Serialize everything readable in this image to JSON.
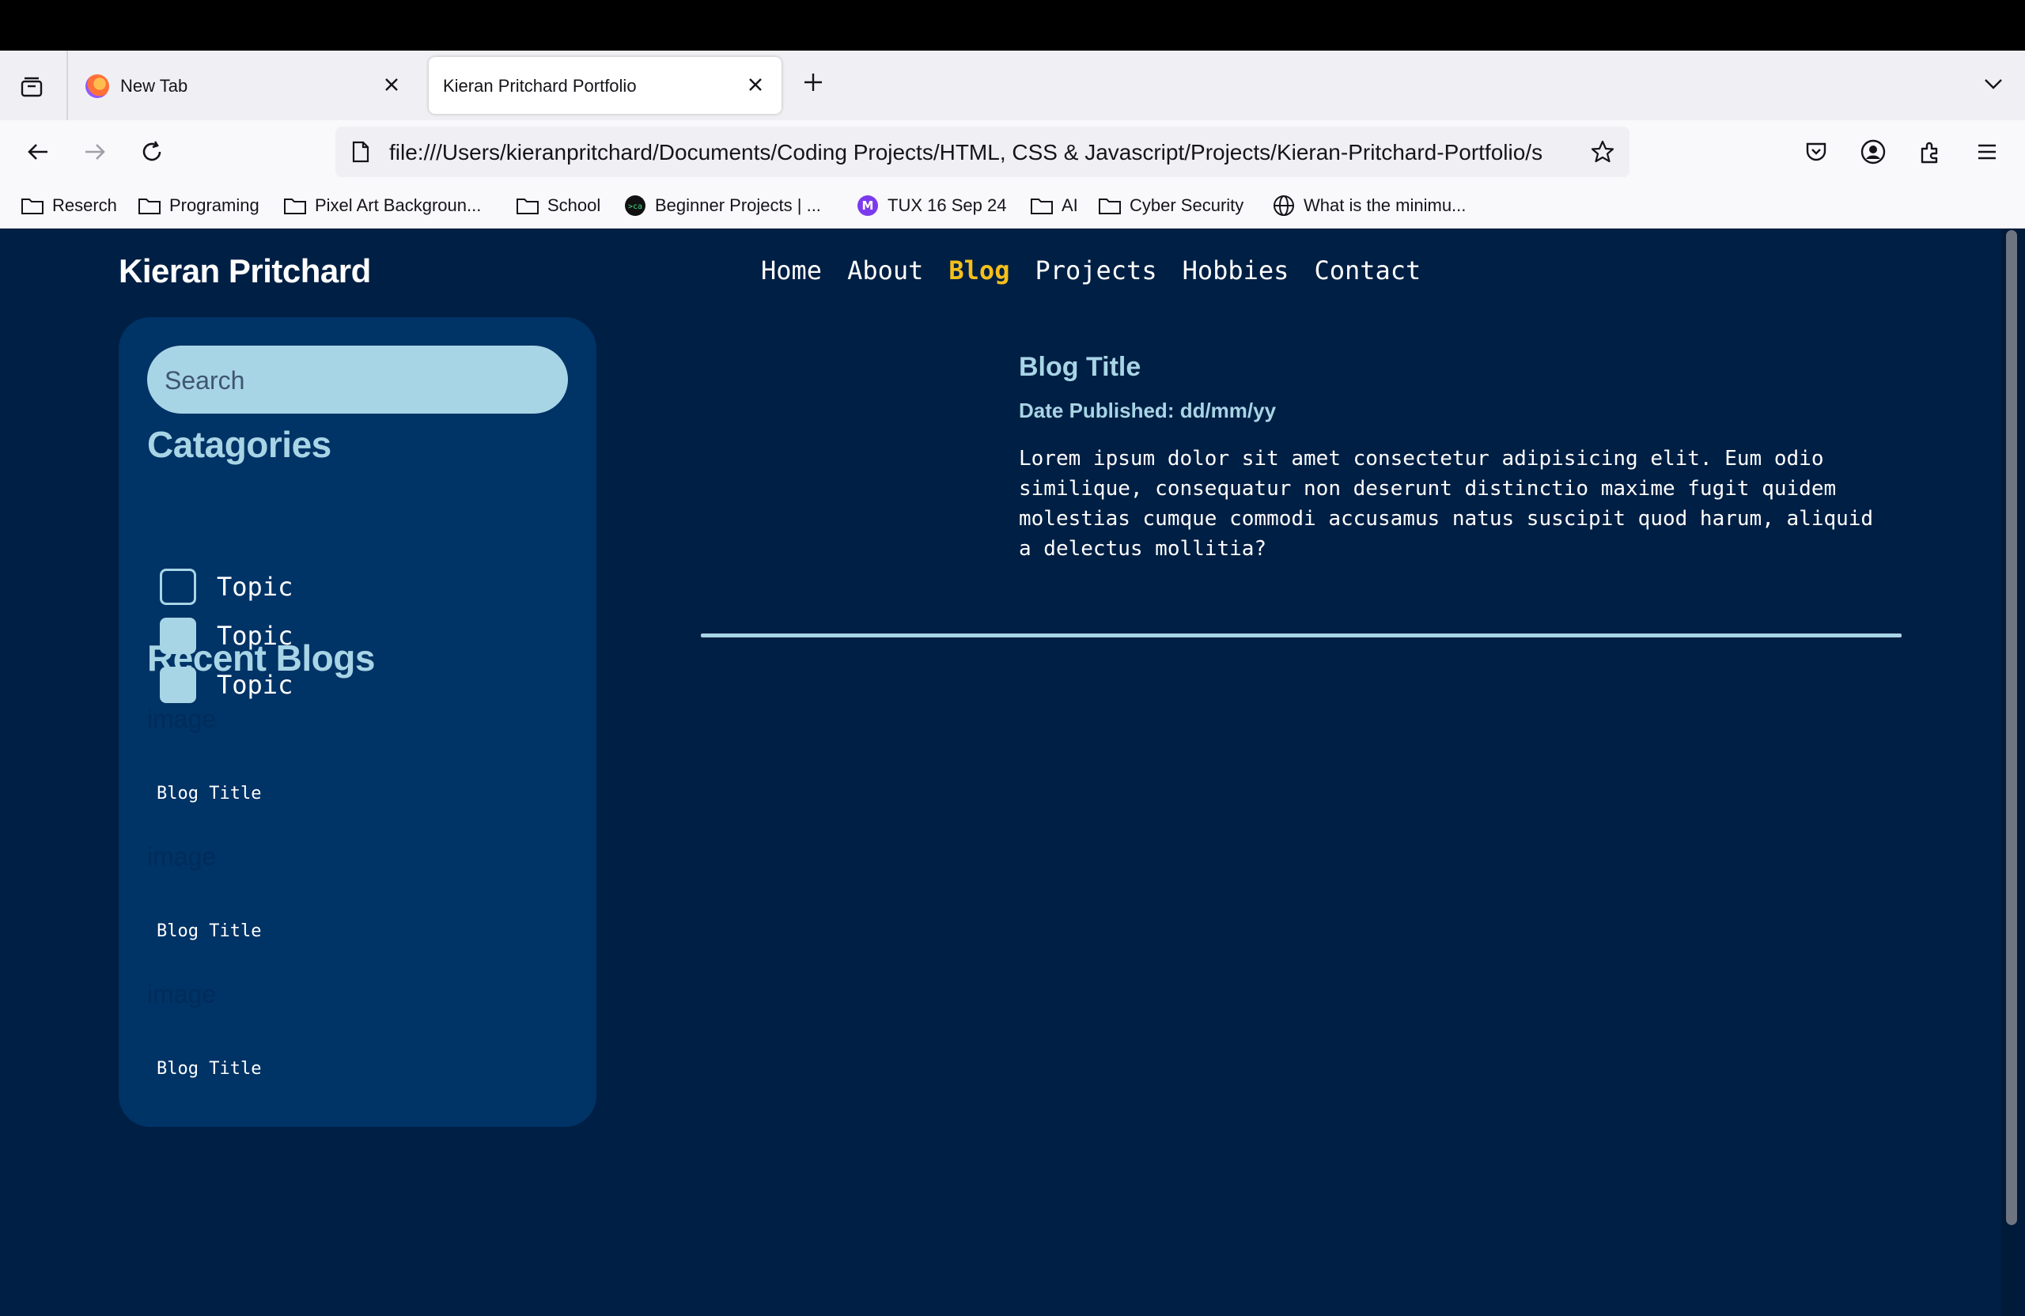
{
  "browser": {
    "tabs": [
      {
        "label": "New Tab",
        "active": false
      },
      {
        "label": "Kieran Pritchard Portfolio",
        "active": true
      }
    ],
    "url": "file:///Users/kieranpritchard/Documents/Coding Projects/HTML, CSS & Javascript/Projects/Kieran-Pritchard-Portfolio/s",
    "bookmarks": [
      {
        "label": "Reserch",
        "icon": "folder-icon"
      },
      {
        "label": "Programing",
        "icon": "folder-icon"
      },
      {
        "label": "Pixel Art Backgroun...",
        "icon": "folder-icon"
      },
      {
        "label": "School",
        "icon": "folder-icon"
      },
      {
        "label": "Beginner Projects | ...",
        "icon": "site-icon"
      },
      {
        "label": "TUX 16 Sep 24",
        "icon": "m-icon"
      },
      {
        "label": "AI",
        "icon": "folder-icon"
      },
      {
        "label": "Cyber Security",
        "icon": "folder-icon"
      },
      {
        "label": "What is the minimu...",
        "icon": "globe-icon"
      }
    ]
  },
  "site": {
    "brand": "Kieran Pritchard",
    "nav": [
      "Home",
      "About",
      "Blog",
      "Projects",
      "Hobbies",
      "Contact"
    ],
    "active_nav": "Blog",
    "accent": "#f5c01a",
    "theme_light": "#a8d5e6",
    "background": "#001f44",
    "panel": "#003366"
  },
  "sidebar": {
    "search_placeholder": "Search",
    "categories_heading": "Catagories",
    "categories": [
      {
        "label": "Topic",
        "checked": false
      },
      {
        "label": "Topic",
        "checked": true
      },
      {
        "label": "Topic",
        "checked": true
      }
    ],
    "recent_heading": "Recent Blogs",
    "recent": [
      {
        "image_alt": "image",
        "title": "Blog Title"
      },
      {
        "image_alt": "image",
        "title": "Blog Title"
      },
      {
        "image_alt": "image",
        "title": "Blog Title"
      }
    ]
  },
  "post": {
    "title": "Blog Title",
    "date": "Date Published: dd/mm/yy",
    "body": "Lorem ipsum dolor sit amet consectetur adipisicing elit. Eum odio similique, consequatur non deserunt distinctio maxime fugit quidem molestias cumque commodi accusamus natus suscipit quod harum, aliquid a delectus mollitia?"
  }
}
